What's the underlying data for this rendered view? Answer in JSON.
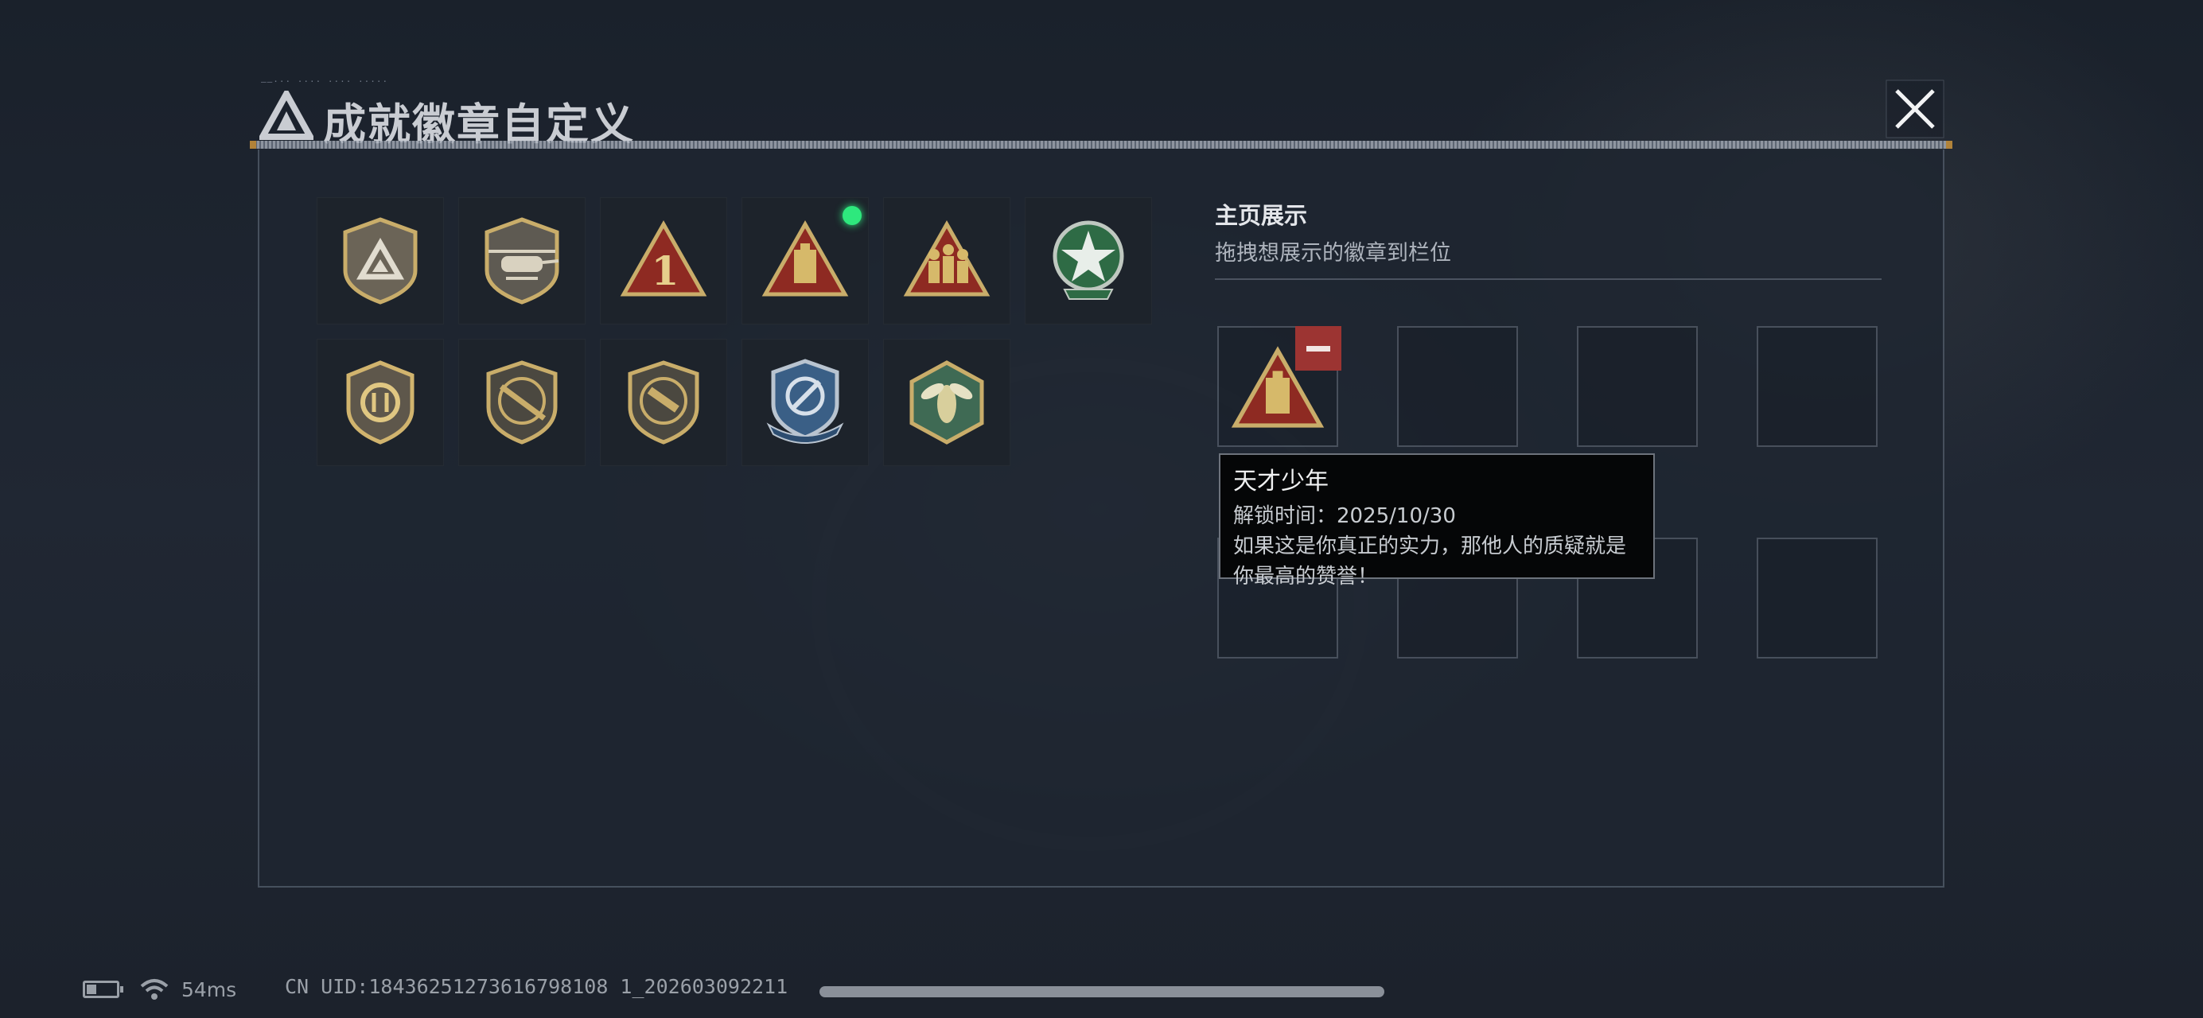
{
  "dialog": {
    "title": "成就徽章自定义",
    "title_deco_text": "——··· ···· ···· ·····"
  },
  "badges": [
    {
      "icon": "shield-triangle-badge-icon",
      "new": false
    },
    {
      "icon": "helicopter-badge-icon",
      "new": false
    },
    {
      "icon": "number-one-triangle-badge-icon",
      "new": false
    },
    {
      "icon": "genius-youth-triangle-badge-icon",
      "new": true
    },
    {
      "icon": "squad-triangle-badge-icon",
      "new": false
    },
    {
      "icon": "green-star-emblem-badge-icon",
      "new": false
    },
    {
      "icon": "gold-emblem-shield-badge-icon",
      "new": false
    },
    {
      "icon": "rifle-shield-badge-icon",
      "new": false
    },
    {
      "icon": "smg-shield-badge-icon",
      "new": false
    },
    {
      "icon": "blue-target-shield-badge-icon",
      "new": false
    },
    {
      "icon": "hornet-hexagon-badge-icon",
      "new": false
    }
  ],
  "showcase": {
    "title": "主页展示",
    "subtitle": "拖拽想展示的徽章到栏位",
    "slots": [
      {
        "filled": true,
        "icon": "genius-youth-triangle-badge-icon"
      },
      {
        "filled": false
      },
      {
        "filled": false
      },
      {
        "filled": false
      },
      {
        "filled": false
      },
      {
        "filled": false
      },
      {
        "filled": false
      },
      {
        "filled": false
      }
    ]
  },
  "tooltip": {
    "name": "天才少年",
    "unlock": "解锁时间：2025/10/30",
    "description": "如果这是你真正的实力，那他人的质疑就是你最高的赞誉！"
  },
  "status_bar": {
    "ping": "54ms",
    "uid": "CN UID:18436251273616798108 1_202603092211"
  },
  "colors": {
    "new_indicator": "#2ee87d",
    "remove_button": "#9c3432",
    "badge_gold": "#c9ad6a",
    "badge_red": "#8e2a22"
  }
}
